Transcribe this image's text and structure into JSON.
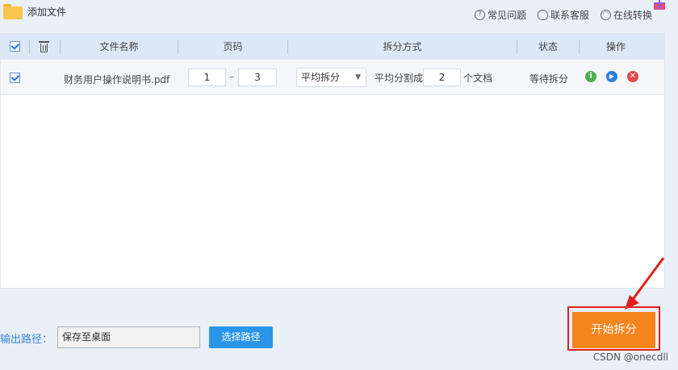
{
  "toolbar": {
    "add_file_label": "添加文件",
    "faq_label": "常见问题",
    "support_label": "联系客服",
    "online_label": "在线转换"
  },
  "table": {
    "headers": {
      "filename": "文件名称",
      "pages": "页码",
      "split_mode": "拆分方式",
      "status": "状态",
      "actions": "操作"
    },
    "rows": [
      {
        "checked": true,
        "filename": "财务用户操作说明书.pdf",
        "page_from": "1",
        "page_sep": "–",
        "page_to": "3",
        "split_option": "平均拆分",
        "split_prefix": "平均分割成",
        "split_count": "2",
        "split_suffix": "个文档",
        "status": "等待拆分"
      }
    ]
  },
  "output": {
    "label": "输出路径：",
    "path": "保存至桌面",
    "choose_label": "选择路径"
  },
  "start_label": "开始拆分",
  "watermark": "CSDN @onecdll",
  "colors": {
    "accent_blue": "#2b95e9",
    "start_orange": "#f7851d",
    "highlight_red": "#e21f1f",
    "info_green": "#4caf50",
    "play_blue": "#2b7fd8",
    "delete_red": "#e64646"
  }
}
